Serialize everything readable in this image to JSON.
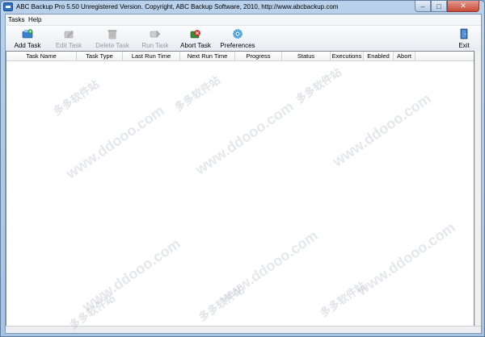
{
  "window": {
    "title": "ABC Backup Pro 5.50  Unregistered Version.  Copyright,  ABC Backup Software, 2010,   http://www.abcbackup.com",
    "minimize": "–",
    "maximize": "□",
    "close": "✕"
  },
  "menu": [
    {
      "label": "Tasks"
    },
    {
      "label": "Help"
    }
  ],
  "toolbar": {
    "add_task": "Add Task",
    "edit_task": "Edit Task",
    "delete_task": "Delete Task",
    "run_task": "Run Task",
    "abort_task": "Abort Task",
    "preferences": "Preferences",
    "exit": "Exit"
  },
  "columns": [
    "Task Name",
    "Task Type",
    "Last Run Time",
    "Next Run Time",
    "Progress",
    "Status",
    "Executions",
    "Enabled",
    "Abort"
  ],
  "watermark": {
    "url": "www.ddooo.com",
    "cn": "多多软件站"
  },
  "colors": {
    "title_bg": "#b9d1ea",
    "close_btn": "#c74a36",
    "client_bg": "#f0f0f0",
    "grid_bg": "#ffffff"
  }
}
